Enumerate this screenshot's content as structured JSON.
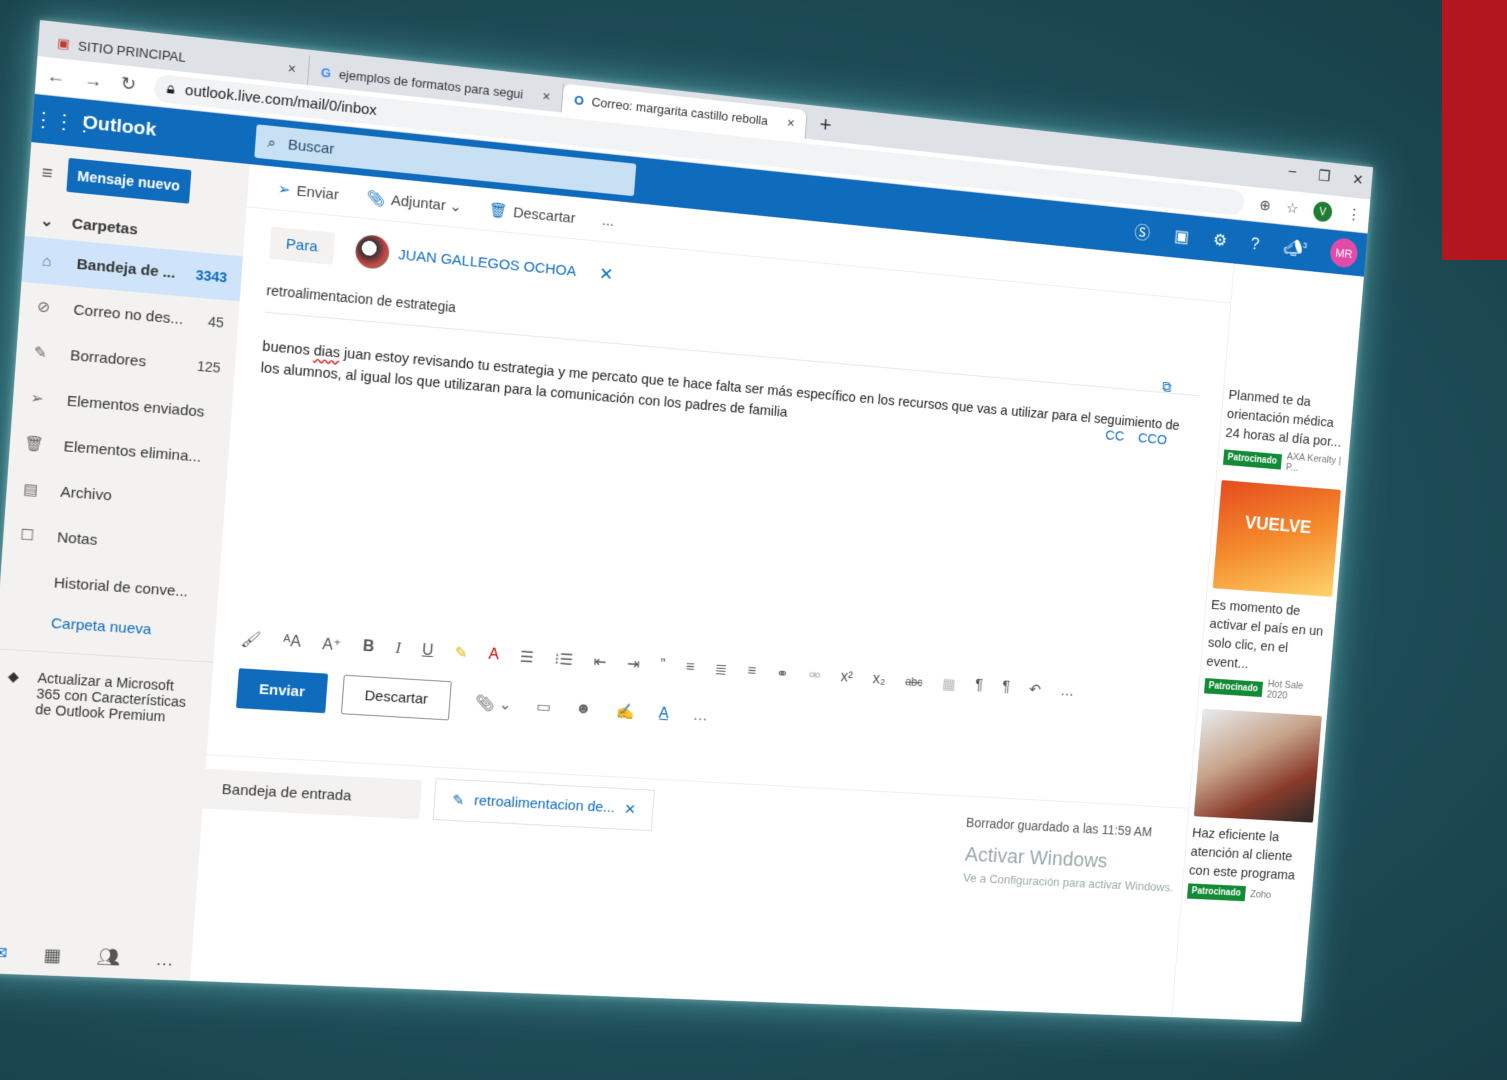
{
  "browser": {
    "tabs": [
      {
        "title": "SITIO PRINCIPAL",
        "close": "×"
      },
      {
        "title": "ejemplos de formatos para segui",
        "close": "×"
      },
      {
        "title": "Correo: margarita castillo rebolla",
        "close": "×"
      }
    ],
    "new_tab": "+",
    "url": "outlook.live.com/mail/0/inbox",
    "profile_initial": "V"
  },
  "outlook": {
    "brand": "Outlook",
    "search_placeholder": "Buscar",
    "user_initials": "MR",
    "notification_count": "3"
  },
  "nav": {
    "new_message": "Mensaje nuevo",
    "folders_header": "Carpetas",
    "folders": [
      {
        "label": "Bandeja de ...",
        "count": "3343"
      },
      {
        "label": "Correo no des...",
        "count": "45"
      },
      {
        "label": "Borradores",
        "count": "125"
      },
      {
        "label": "Elementos enviados",
        "count": ""
      },
      {
        "label": "Elementos elimina...",
        "count": ""
      },
      {
        "label": "Archivo",
        "count": ""
      },
      {
        "label": "Notas",
        "count": ""
      },
      {
        "label": "Historial de conve...",
        "count": ""
      }
    ],
    "new_folder": "Carpeta nueva",
    "upgrade": "Actualizar a Microsoft 365 con Características de Outlook Premium"
  },
  "command_bar": {
    "send": "Enviar",
    "attach": "Adjuntar",
    "discard": "Descartar",
    "more": "..."
  },
  "compose": {
    "to_label": "Para",
    "recipient": "JUAN GALLEGOS OCHOA",
    "cc": "CC",
    "bcc": "CCO",
    "subject": "retroalimentacion de estrategia",
    "body_word1": "buenos",
    "body_misspelled": "dias",
    "body_rest": " juan estoy revisando tu estrategia y me percato que te hace falta ser más específico en los recursos que vas a utilizar para el seguimiento de los alumnos, al igual los que utilizaran para la comunicación con los padres de familia",
    "send_button": "Enviar",
    "discard_button": "Descartar"
  },
  "statusbar": {
    "inbox_tab": "Bandeja de entrada",
    "draft_tab": "retroalimentacion de...",
    "saved": "Borrador guardado a las 11:59 AM",
    "activate_title": "Activar Windows",
    "activate_sub": "Ve a Configuración para activar Windows."
  },
  "ads": [
    {
      "text": "Planmed te da orientación médica 24 horas al día por...",
      "badge": "Patrocinado",
      "source": "AXA Keralty | P..."
    },
    {
      "text": "Es momento de activar el país en un solo clic, en el event...",
      "badge": "Patrocinado",
      "source": "Hot Sale 2020",
      "banner": "VUELVE"
    },
    {
      "text": "Haz eficiente la atención al cliente con este programa",
      "badge": "Patrocinado",
      "source": "Zoho"
    }
  ]
}
